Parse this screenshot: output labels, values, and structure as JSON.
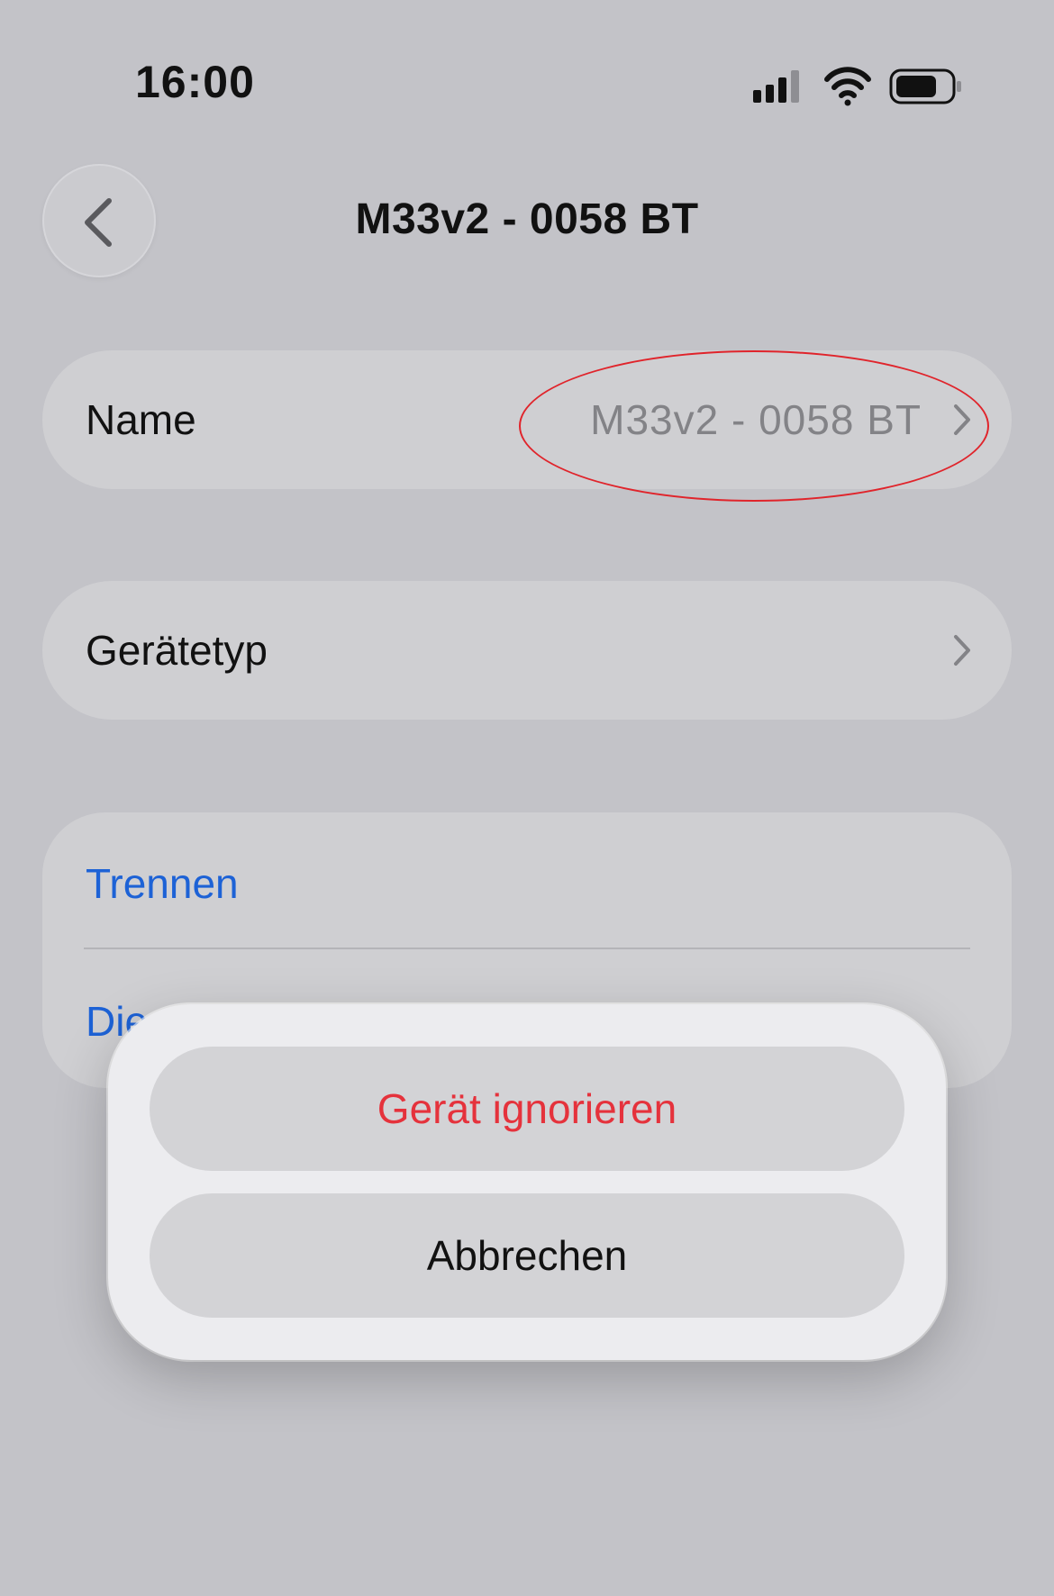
{
  "status_bar": {
    "time": "16:00",
    "icons": [
      "cellular-signal-icon",
      "wifi-icon",
      "battery-icon"
    ]
  },
  "nav": {
    "back_icon": "chevron-left-icon",
    "title": "M33v2 - 0058 BT"
  },
  "rows": {
    "name": {
      "label": "Name",
      "value": "M33v2 - 0058 BT",
      "icon": "chevron-right-icon"
    },
    "device_type": {
      "label": "Gerätetyp",
      "icon": "chevron-right-icon"
    }
  },
  "actions_group": {
    "disconnect": "Trennen",
    "partially_hidden": "Die"
  },
  "action_sheet": {
    "ignore_device": "Gerät ignorieren",
    "cancel": "Abbrechen"
  },
  "colors": {
    "background": "#c3c3c8",
    "link_blue": "#1d62d6",
    "destructive_red": "#e5323c",
    "annotation_red": "#e0242b"
  }
}
